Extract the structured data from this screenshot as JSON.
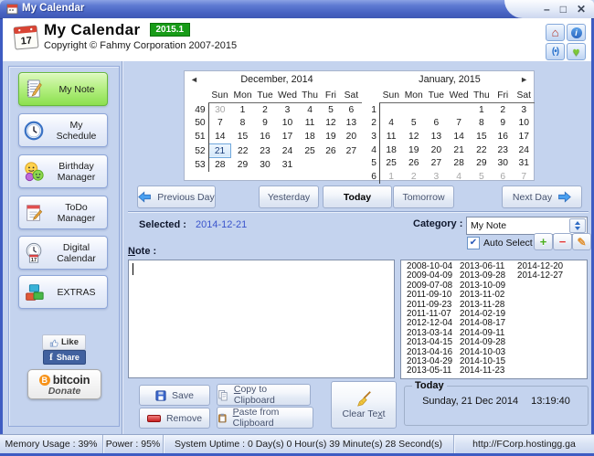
{
  "colors": {
    "titlebar_blue": "#4762c2",
    "badge_green": "#189c18",
    "active_green": "#8ce04e",
    "facebook_blue": "#41619f",
    "bitcoin_orange": "#f7931a",
    "selected_day_border": "#70a8dc"
  },
  "icons": {
    "minimize": "–",
    "maximize": "□",
    "close": "✕",
    "home": "⌂",
    "info": "i",
    "wireless": "((•))",
    "heart": "♥",
    "check": "✔",
    "plus": "+",
    "minus": "−",
    "pencil": "✎",
    "prev_month": "◄",
    "next_month": "►",
    "facebook_f": "f",
    "bitcoin_b": "B"
  },
  "window": {
    "title": "My Calendar"
  },
  "header": {
    "app_name": "My Calendar",
    "version": "2015.1",
    "logo_day": "17",
    "copyright": "Copyright © Fahmy Corporation 2007-2015"
  },
  "sidebar": {
    "items": [
      {
        "label": "My Note",
        "active": true
      },
      {
        "label": "My Schedule",
        "active": false
      },
      {
        "label": "Birthday Manager",
        "active": false
      },
      {
        "label": "ToDo Manager",
        "active": false
      },
      {
        "label": "Digital Calendar",
        "active": false
      },
      {
        "label": "EXTRAS",
        "active": false
      }
    ],
    "social": {
      "like": "Like",
      "share": "Share",
      "donate_brand": "bitcoin",
      "donate_label": "Donate"
    }
  },
  "calendar": {
    "months": [
      {
        "title": "December, 2014",
        "day_headers": [
          "Sun",
          "Mon",
          "Tue",
          "Wed",
          "Thu",
          "Fri",
          "Sat"
        ],
        "rows": [
          {
            "week": "49",
            "days": [
              {
                "t": "30",
                "cls": "muted"
              },
              {
                "t": "1"
              },
              {
                "t": "2"
              },
              {
                "t": "3"
              },
              {
                "t": "4"
              },
              {
                "t": "5"
              },
              {
                "t": "6"
              }
            ]
          },
          {
            "week": "50",
            "days": [
              {
                "t": "7"
              },
              {
                "t": "8"
              },
              {
                "t": "9"
              },
              {
                "t": "10"
              },
              {
                "t": "11"
              },
              {
                "t": "12"
              },
              {
                "t": "13"
              }
            ]
          },
          {
            "week": "51",
            "days": [
              {
                "t": "14"
              },
              {
                "t": "15"
              },
              {
                "t": "16"
              },
              {
                "t": "17"
              },
              {
                "t": "18"
              },
              {
                "t": "19"
              },
              {
                "t": "20"
              }
            ]
          },
          {
            "week": "52",
            "days": [
              {
                "t": "21",
                "cls": "selected"
              },
              {
                "t": "22"
              },
              {
                "t": "23"
              },
              {
                "t": "24"
              },
              {
                "t": "25"
              },
              {
                "t": "26"
              },
              {
                "t": "27"
              }
            ]
          },
          {
            "week": "53",
            "days": [
              {
                "t": "28"
              },
              {
                "t": "29"
              },
              {
                "t": "30"
              },
              {
                "t": "31"
              },
              {
                "t": ""
              },
              {
                "t": ""
              },
              {
                "t": ""
              }
            ]
          }
        ]
      },
      {
        "title": "January, 2015",
        "day_headers": [
          "Sun",
          "Mon",
          "Tue",
          "Wed",
          "Thu",
          "Fri",
          "Sat"
        ],
        "rows": [
          {
            "week": "1",
            "days": [
              {
                "t": ""
              },
              {
                "t": ""
              },
              {
                "t": ""
              },
              {
                "t": ""
              },
              {
                "t": "1"
              },
              {
                "t": "2"
              },
              {
                "t": "3"
              }
            ]
          },
          {
            "week": "2",
            "days": [
              {
                "t": "4"
              },
              {
                "t": "5"
              },
              {
                "t": "6"
              },
              {
                "t": "7"
              },
              {
                "t": "8"
              },
              {
                "t": "9"
              },
              {
                "t": "10"
              }
            ]
          },
          {
            "week": "3",
            "days": [
              {
                "t": "11"
              },
              {
                "t": "12"
              },
              {
                "t": "13"
              },
              {
                "t": "14"
              },
              {
                "t": "15"
              },
              {
                "t": "16"
              },
              {
                "t": "17"
              }
            ]
          },
          {
            "week": "4",
            "days": [
              {
                "t": "18"
              },
              {
                "t": "19"
              },
              {
                "t": "20"
              },
              {
                "t": "21"
              },
              {
                "t": "22"
              },
              {
                "t": "23"
              },
              {
                "t": "24"
              }
            ]
          },
          {
            "week": "5",
            "days": [
              {
                "t": "25"
              },
              {
                "t": "26"
              },
              {
                "t": "27"
              },
              {
                "t": "28"
              },
              {
                "t": "29"
              },
              {
                "t": "30"
              },
              {
                "t": "31"
              }
            ]
          },
          {
            "week": "6",
            "days": [
              {
                "t": "1",
                "cls": "muted"
              },
              {
                "t": "2",
                "cls": "muted"
              },
              {
                "t": "3",
                "cls": "muted"
              },
              {
                "t": "4",
                "cls": "muted"
              },
              {
                "t": "5",
                "cls": "muted"
              },
              {
                "t": "6",
                "cls": "muted"
              },
              {
                "t": "7",
                "cls": "muted"
              }
            ]
          }
        ]
      }
    ]
  },
  "nav": {
    "previous_day": "Previous Day",
    "yesterday": "Yesterday",
    "today": "Today",
    "tomorrow": "Tomorrow",
    "next_day": "Next Day"
  },
  "selection": {
    "label": "Selected :",
    "value": "2014-12-21",
    "category_label": "Category :",
    "category_value": "My Note",
    "auto_select": "Auto Select"
  },
  "note": {
    "label": "&Note :",
    "value": ""
  },
  "dates_list": {
    "columns": [
      [
        "2008-10-04",
        "2009-04-09",
        "2009-07-08",
        "2011-09-10",
        "2011-09-23",
        "2011-11-07",
        "2012-12-04",
        "2013-03-14",
        "2013-04-15",
        "2013-04-16",
        "2013-04-29",
        "2013-05-11"
      ],
      [
        "2013-06-11",
        "2013-09-28",
        "2013-10-09",
        "2013-11-02",
        "2013-11-28",
        "2014-02-19",
        "2014-08-17",
        "2014-09-11",
        "2014-09-28",
        "2014-10-03",
        "2014-10-15",
        "2014-11-23"
      ],
      [
        "2014-12-20",
        "2014-12-27"
      ]
    ]
  },
  "actions": {
    "save": "Save",
    "remove": "Remove",
    "copy": "&Copy to Clipboard",
    "paste": "&Paste from Clipboard",
    "clear": "Clear Te&xt"
  },
  "today_box": {
    "title": "Today",
    "date": "Sunday, 21 Dec 2014",
    "time": "13:19:40"
  },
  "status_bar": {
    "memory": "Memory Usage : 39%",
    "power": "Power : 95%",
    "uptime": "System Uptime : 0 Day(s) 0 Hour(s) 39 Minute(s) 28 Second(s)",
    "url": "http://FCorp.hostingg.ga"
  }
}
